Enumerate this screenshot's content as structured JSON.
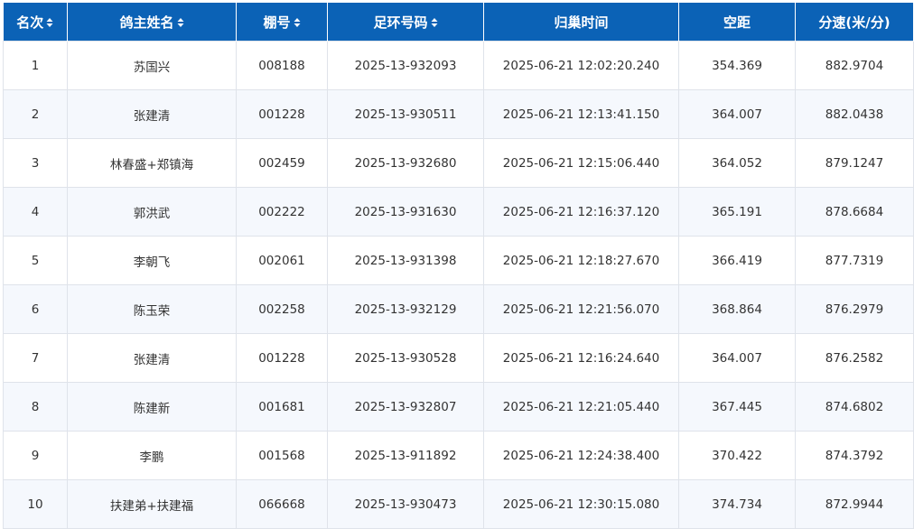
{
  "table": {
    "headers": [
      {
        "label": "名次",
        "sortable": true
      },
      {
        "label": "鸽主姓名",
        "sortable": true
      },
      {
        "label": "棚号",
        "sortable": true
      },
      {
        "label": "足环号码",
        "sortable": true
      },
      {
        "label": "归巢时间",
        "sortable": false
      },
      {
        "label": "空距",
        "sortable": false
      },
      {
        "label": "分速(米/分)",
        "sortable": false
      }
    ],
    "rows": [
      [
        "1",
        "苏国兴",
        "008188",
        "2025-13-932093",
        "2025-06-21 12:02:20.240",
        "354.369",
        "882.9704"
      ],
      [
        "2",
        "张建清",
        "001228",
        "2025-13-930511",
        "2025-06-21 12:13:41.150",
        "364.007",
        "882.0438"
      ],
      [
        "3",
        "林春盛+郑镇海",
        "002459",
        "2025-13-932680",
        "2025-06-21 12:15:06.440",
        "364.052",
        "879.1247"
      ],
      [
        "4",
        "郭洪武",
        "002222",
        "2025-13-931630",
        "2025-06-21 12:16:37.120",
        "365.191",
        "878.6684"
      ],
      [
        "5",
        "李朝飞",
        "002061",
        "2025-13-931398",
        "2025-06-21 12:18:27.670",
        "366.419",
        "877.7319"
      ],
      [
        "6",
        "陈玉荣",
        "002258",
        "2025-13-932129",
        "2025-06-21 12:21:56.070",
        "368.864",
        "876.2979"
      ],
      [
        "7",
        "张建清",
        "001228",
        "2025-13-930528",
        "2025-06-21 12:16:24.640",
        "364.007",
        "876.2582"
      ],
      [
        "8",
        "陈建新",
        "001681",
        "2025-13-932807",
        "2025-06-21 12:21:05.440",
        "367.445",
        "874.6802"
      ],
      [
        "9",
        "李鹏",
        "001568",
        "2025-13-911892",
        "2025-06-21 12:24:38.400",
        "370.422",
        "874.3792"
      ],
      [
        "10",
        "扶建弟+扶建福",
        "066668",
        "2025-13-930473",
        "2025-06-21 12:30:15.080",
        "374.734",
        "872.9944"
      ]
    ]
  },
  "colors": {
    "header_bg": "#0b62b6",
    "header_text": "#ffffff",
    "row_alt_bg": "#f5f8fd",
    "border": "#dfe3ea",
    "cell_text": "#333333"
  }
}
